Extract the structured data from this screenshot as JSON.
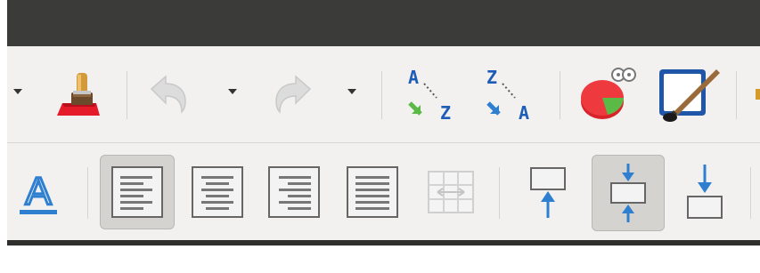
{
  "window": {
    "titlebar_color": "#3b3b39"
  },
  "toolbar_top": {
    "buttons": [
      {
        "name": "dropdown-arrow-icon"
      },
      {
        "name": "clone-formatting-icon"
      },
      {
        "name": "undo-icon",
        "enabled": false
      },
      {
        "name": "redo-icon",
        "enabled": false
      },
      {
        "name": "sort-ascending-icon",
        "text": [
          "A",
          "Z"
        ]
      },
      {
        "name": "sort-descending-icon",
        "text": [
          "Z",
          "A"
        ]
      },
      {
        "name": "insert-chart-icon"
      },
      {
        "name": "draw-functions-icon"
      }
    ]
  },
  "toolbar_bottom": {
    "font_color_letter": "A",
    "align_buttons": [
      {
        "name": "align-left",
        "pressed": true
      },
      {
        "name": "align-center",
        "pressed": false
      },
      {
        "name": "align-right",
        "pressed": false
      },
      {
        "name": "justify",
        "pressed": false
      },
      {
        "name": "merge-cells",
        "enabled": false
      }
    ],
    "valign_buttons": [
      {
        "name": "align-top",
        "pressed": false
      },
      {
        "name": "center-vertically",
        "pressed": true
      },
      {
        "name": "align-bottom",
        "pressed": false
      }
    ]
  },
  "colors": {
    "accent_blue": "#2f7fd0",
    "chart_red": "#d8232a",
    "chart_green": "#5bb946"
  }
}
